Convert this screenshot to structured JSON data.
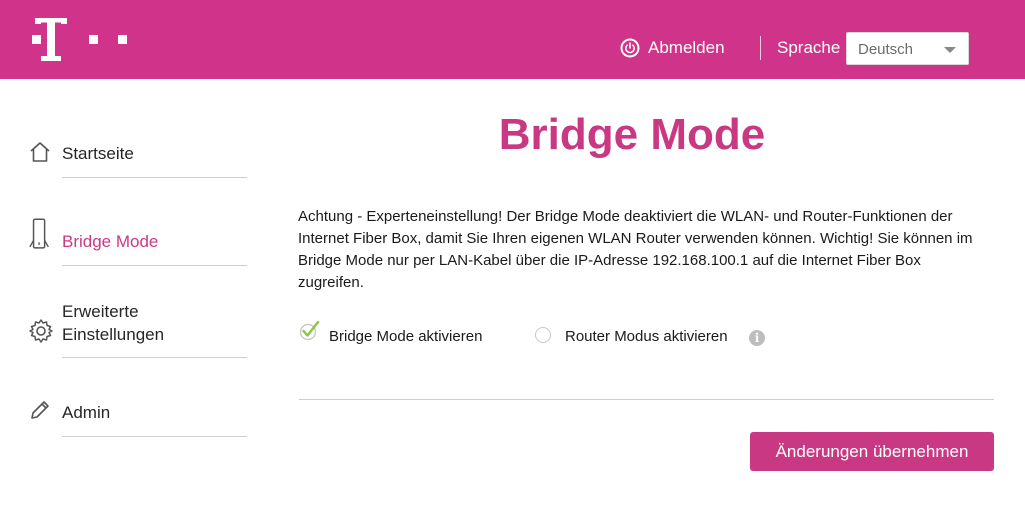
{
  "header": {
    "logout_label": "Abmelden",
    "language_label": "Sprache",
    "language_selected": "Deutsch"
  },
  "sidebar": {
    "items": [
      {
        "label": "Startseite",
        "icon": "home-icon",
        "active": false
      },
      {
        "label": "Bridge Mode",
        "icon": "device-icon",
        "active": true
      },
      {
        "label": "Erweiterte\nEinstellungen",
        "label_line1": "Erweiterte",
        "label_line2": "Einstellungen",
        "icon": "gear-icon",
        "active": false
      },
      {
        "label": "Admin",
        "icon": "pencil-icon",
        "active": false
      }
    ]
  },
  "main": {
    "title": "Bridge Mode",
    "description": "Achtung - Experteneinstellung! Der Bridge Mode deaktiviert die WLAN- und Router-Funktionen der Internet Fiber Box, damit Sie Ihren eigenen WLAN Router verwenden können. Wichtig! Sie können im Bridge Mode nur per LAN-Kabel über die IP-Adresse 192.168.100.1 auf die Internet Fiber Box zugreifen.",
    "options": [
      {
        "label": "Bridge Mode aktivieren",
        "selected": true
      },
      {
        "label": "Router Modus aktivieren",
        "selected": false
      }
    ],
    "info_icon": "i",
    "apply_label": "Änderungen übernehmen"
  },
  "colors": {
    "brand": "#d0348a",
    "accent": "#c93983",
    "check": "#8cc63f"
  }
}
